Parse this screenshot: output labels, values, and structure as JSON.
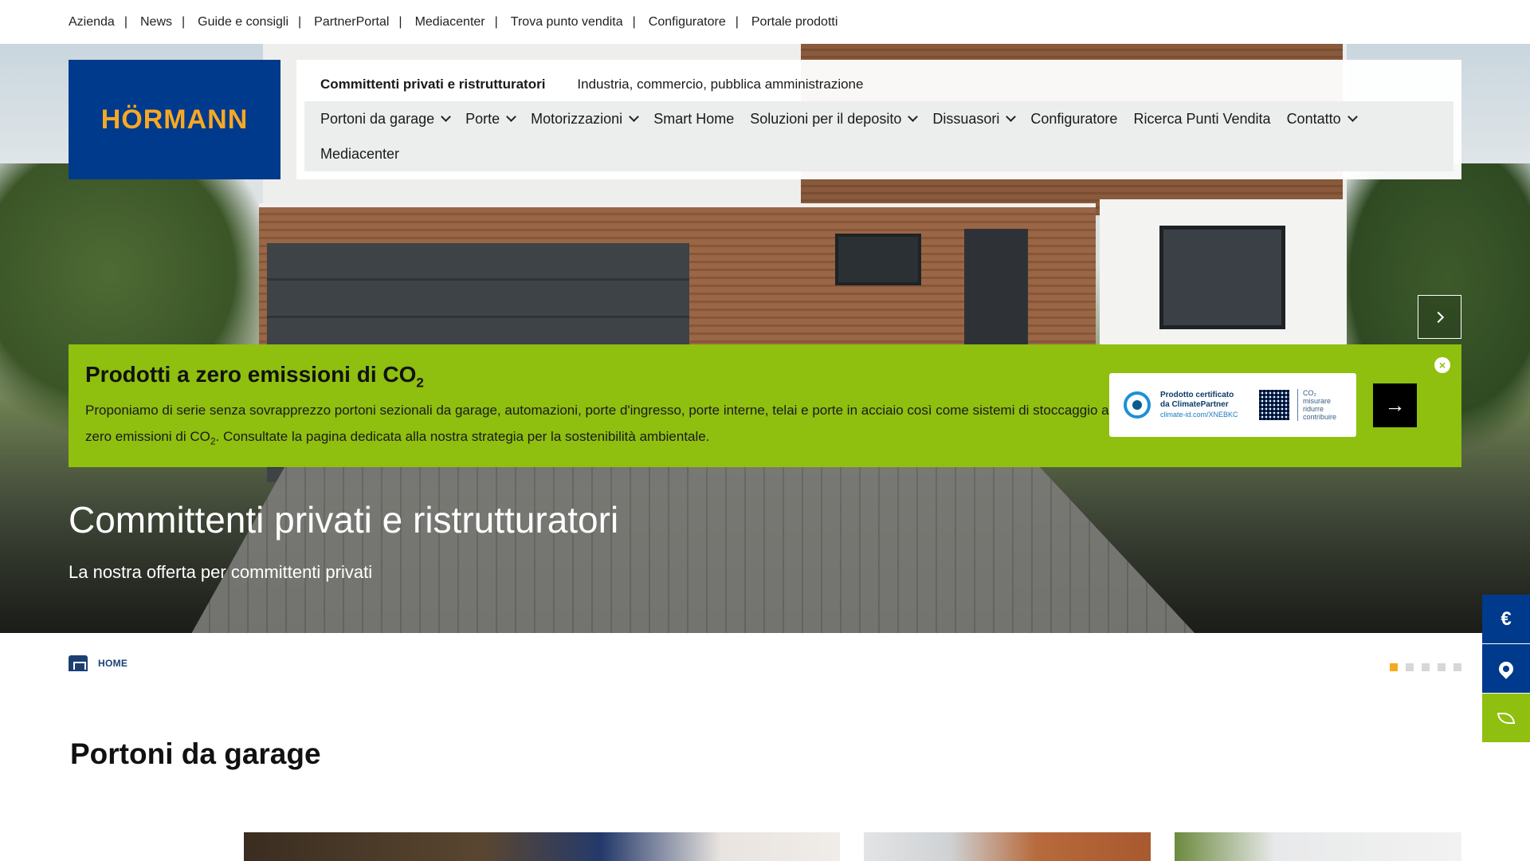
{
  "topbar": {
    "links": [
      "Azienda",
      "News",
      "Guide e consigli",
      "PartnerPortal",
      "Mediacenter",
      "Trova punto vendita",
      "Configuratore",
      "Portale prodotti"
    ],
    "separator": "|"
  },
  "brand": {
    "logo_text": "HÖRMANN"
  },
  "audience_tabs": [
    {
      "label": "Committenti privati e ristrutturatori",
      "active": true
    },
    {
      "label": "Industria, commercio, pubblica amministrazione",
      "active": false
    }
  ],
  "nav": {
    "items": [
      {
        "label": "Portoni da garage",
        "dropdown": true
      },
      {
        "label": "Porte",
        "dropdown": true
      },
      {
        "label": "Motorizzazioni",
        "dropdown": true
      },
      {
        "label": "Smart Home",
        "dropdown": false
      },
      {
        "label": "Soluzioni per il deposito",
        "dropdown": true
      },
      {
        "label": "Dissuasori",
        "dropdown": true
      },
      {
        "label": "Configuratore",
        "dropdown": false
      },
      {
        "label": "Ricerca Punti Vendita",
        "dropdown": false
      },
      {
        "label": "Contatto",
        "dropdown": true
      },
      {
        "label": "Mediacenter",
        "dropdown": false
      }
    ]
  },
  "co2": {
    "title_prefix": "Prodotti a zero emissioni di CO",
    "title_sub": "2",
    "text_part1": "Proponiamo di serie senza sovrapprezzo portoni sezionali da garage, automazioni, porte d'ingresso, porte interne, telai e porte in acciaio così come sistemi di stoccaggio a zero emissioni di CO",
    "text_sub": "2",
    "text_part2": ". Consultate la pagina dedicata alla nostra strategia per la sostenibilità ambientale.",
    "cert": {
      "line1": "Prodotto certificato",
      "line2": "da ClimatePartner",
      "line3": "climate-id.com/XNEBKC",
      "side1": "CO₂",
      "side2": "misurare",
      "side3": "ridurre",
      "side4": "contribuire"
    },
    "arrow_glyph": "→",
    "close_glyph": "×"
  },
  "hero": {
    "title": "Committenti privati e ristrutturatori",
    "subtitle": "La nostra offerta per committenti privati",
    "slide_count": 5,
    "active_slide": 1
  },
  "side_actions": {
    "price_glyph": "€"
  },
  "breadcrumb": {
    "home_label": "HOME"
  },
  "section": {
    "title_light": "Portoni ",
    "title_bold": "da garage"
  },
  "colors": {
    "brand_blue": "#003a8c",
    "brand_orange": "#f7a823",
    "eco_green": "#8fbf0f"
  }
}
